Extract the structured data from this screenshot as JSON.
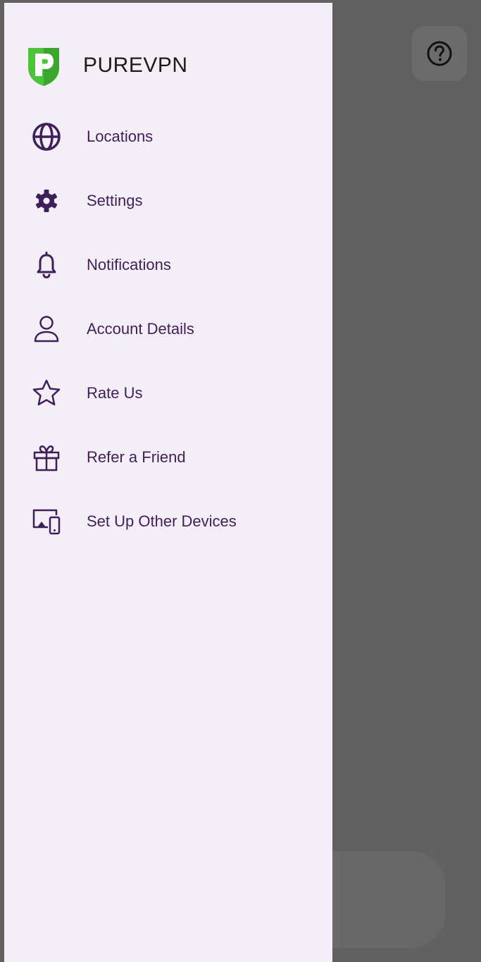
{
  "colors": {
    "drawer_background": "#f4eff6",
    "scrim": "#616161",
    "menu_text": "#3f1f5a",
    "icon": "#3f1f5a",
    "brand_green": "#4cc43a"
  },
  "background_app": {
    "help_icon": "help-circle-icon"
  },
  "drawer": {
    "brand": {
      "logo_icon": "purevpn-logo-icon",
      "name": "PUREVPN"
    },
    "items": [
      {
        "icon": "globe-icon",
        "label": "Locations"
      },
      {
        "icon": "gear-icon",
        "label": "Settings"
      },
      {
        "icon": "bell-icon",
        "label": "Notifications"
      },
      {
        "icon": "person-icon",
        "label": "Account Details"
      },
      {
        "icon": "star-icon",
        "label": "Rate Us"
      },
      {
        "icon": "gift-icon",
        "label": "Refer a Friend"
      },
      {
        "icon": "devices-icon",
        "label": "Set Up Other Devices"
      }
    ]
  }
}
